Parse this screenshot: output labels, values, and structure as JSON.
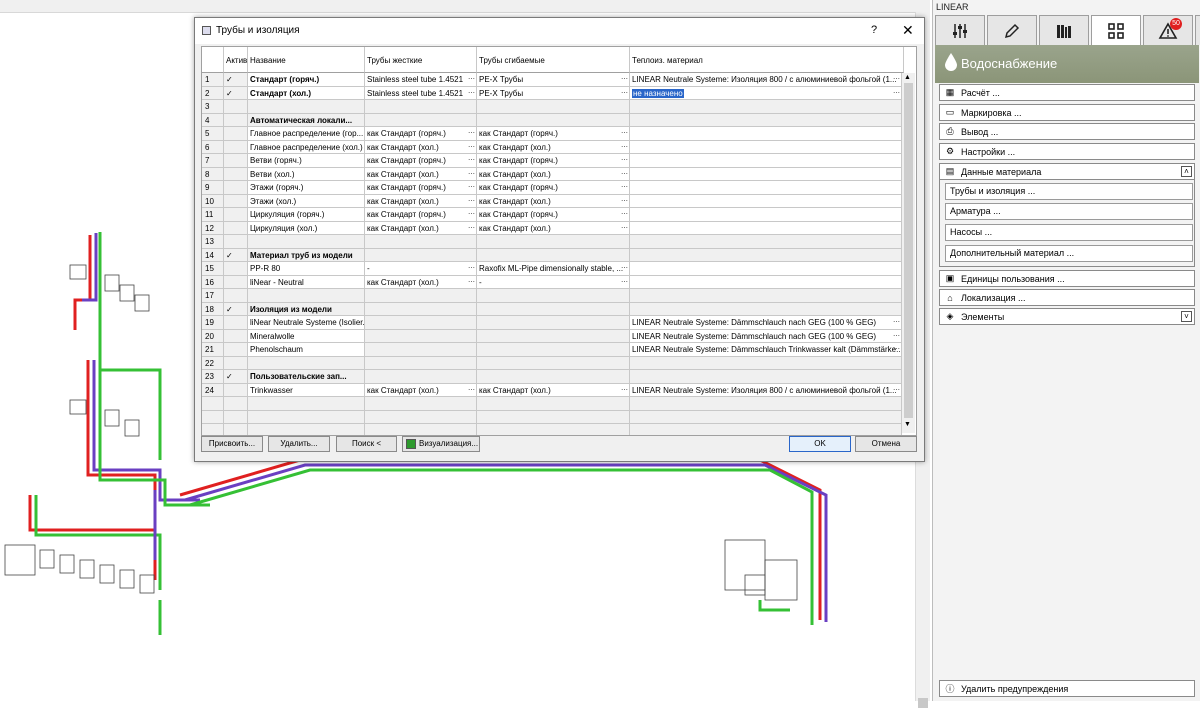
{
  "panel": {
    "title": "LINEAR",
    "badge_count": "50",
    "section_title": "Водоснабжение",
    "buttons": {
      "calc": "Расчёт ...",
      "marking": "Маркировка ...",
      "output": "Вывод ...",
      "settings": "Настройки ...",
      "material_data": "Данные материала",
      "units": "Единицы пользования ...",
      "localization": "Локализация ...",
      "elements": "Элементы",
      "delete_warnings": "Удалить предупреждения"
    },
    "sub_buttons": {
      "pipes": "Трубы и изоляция ...",
      "fittings": "Арматура ...",
      "pumps": "Насосы ...",
      "extra": "Дополнительный материал ..."
    },
    "colors": {
      "header": "#8b9578",
      "badge": "#e02020"
    }
  },
  "dialog": {
    "title": "Трубы и изоляция",
    "help": "?",
    "close": "✕",
    "columns": {
      "active": "Актив",
      "name": "Название",
      "rigid": "Трубы жесткие",
      "flexible": "Трубы сгибаемые",
      "insulation": "Теплоиз. материал"
    },
    "rows": [
      {
        "n": "1",
        "check": "✓",
        "name": "Стандарт (горяч.)",
        "bold": true,
        "rigid": "Stainless steel tube 1.4521",
        "flex": "PE-X Трубы",
        "ins": "LINEAR Neutrale Systeme: Изоляция 800 / с алюминиевой фольгой (1...",
        "w": true
      },
      {
        "n": "2",
        "check": "✓",
        "name": "Стандарт (хол.)",
        "bold": true,
        "rigid": "Stainless steel tube 1.4521",
        "flex": "PE-X Трубы",
        "ins": "не назначено",
        "w": true,
        "sel": true
      },
      {
        "n": "3",
        "check": "",
        "name": "",
        "rigid": "",
        "flex": "",
        "ins": ""
      },
      {
        "n": "4",
        "check": "",
        "name": "Автоматическая локали...",
        "bold": true,
        "rigid": "",
        "flex": "",
        "ins": ""
      },
      {
        "n": "5",
        "check": "",
        "name": "Главное распределение (гор...",
        "rigid": "как Стандарт (горяч.)",
        "flex": "как Стандарт (горяч.)",
        "ins": "",
        "w": true
      },
      {
        "n": "6",
        "check": "",
        "name": "Главное распределение (хол.)",
        "rigid": "как Стандарт (хол.)",
        "flex": "как Стандарт (хол.)",
        "ins": "",
        "w": true
      },
      {
        "n": "7",
        "check": "",
        "name": "Ветви (горяч.)",
        "rigid": "как Стандарт (горяч.)",
        "flex": "как Стандарт (горяч.)",
        "ins": "",
        "w": true
      },
      {
        "n": "8",
        "check": "",
        "name": "Ветви (хол.)",
        "rigid": "как Стандарт (хол.)",
        "flex": "как Стандарт (хол.)",
        "ins": "",
        "w": true
      },
      {
        "n": "9",
        "check": "",
        "name": "Этажи (горяч.)",
        "rigid": "как Стандарт (горяч.)",
        "flex": "как Стандарт (горяч.)",
        "ins": "",
        "w": true
      },
      {
        "n": "10",
        "check": "",
        "name": "Этажи (хол.)",
        "rigid": "как Стандарт (хол.)",
        "flex": "как Стандарт (хол.)",
        "ins": "",
        "w": true
      },
      {
        "n": "11",
        "check": "",
        "name": "Циркуляция (горяч.)",
        "rigid": "как Стандарт (горяч.)",
        "flex": "как Стандарт (горяч.)",
        "ins": "",
        "w": true
      },
      {
        "n": "12",
        "check": "",
        "name": "Циркуляция (хол.)",
        "rigid": "как Стандарт (хол.)",
        "flex": "как Стандарт (хол.)",
        "ins": "",
        "w": true
      },
      {
        "n": "13",
        "check": "",
        "name": "",
        "rigid": "",
        "flex": "",
        "ins": ""
      },
      {
        "n": "14",
        "check": "✓",
        "name": "Материал труб из модели",
        "bold": true,
        "rigid": "",
        "flex": "",
        "ins": ""
      },
      {
        "n": "15",
        "check": "",
        "name": "PP-R 80",
        "rigid": "-",
        "flex": "Raxofix ML-Pipe dimensionally stable, ...",
        "ins": "",
        "w": true
      },
      {
        "n": "16",
        "check": "",
        "name": "liNear - Neutral",
        "rigid": "как Стандарт (хол.)",
        "flex": "-",
        "ins": "",
        "w": true
      },
      {
        "n": "17",
        "check": "",
        "name": "",
        "rigid": "",
        "flex": "",
        "ins": ""
      },
      {
        "n": "18",
        "check": "✓",
        "name": "Изоляция из модели",
        "bold": true,
        "rigid": "",
        "flex": "",
        "ins": ""
      },
      {
        "n": "19",
        "check": "",
        "name": "liNear Neutrale Systeme (Isolier...",
        "rigid": "",
        "flex": "",
        "ins": "LINEAR Neutrale Systeme: Dämmschlauch nach GEG (100 % GEG)",
        "w": true
      },
      {
        "n": "20",
        "check": "",
        "name": "Mineralwolle",
        "rigid": "",
        "flex": "",
        "ins": "LINEAR Neutrale Systeme: Dämmschlauch nach GEG (100 % GEG)",
        "w": true
      },
      {
        "n": "21",
        "check": "",
        "name": "Phenolschaum",
        "rigid": "",
        "flex": "",
        "ins": "LINEAR Neutrale Systeme: Dämmschlauch Trinkwasser kalt (Dämmstärke...",
        "w": true
      },
      {
        "n": "22",
        "check": "",
        "name": "",
        "rigid": "",
        "flex": "",
        "ins": ""
      },
      {
        "n": "23",
        "check": "✓",
        "name": "Пользовательские зап...",
        "bold": true,
        "rigid": "",
        "flex": "",
        "ins": ""
      },
      {
        "n": "24",
        "check": "",
        "name": "Trinkwasser",
        "rigid": "как Стандарт (хол.)",
        "flex": "как Стандарт (хол.)",
        "ins": "LINEAR Neutrale Systeme: Изоляция 800 / с алюминиевой фольгой (1...",
        "w": true
      }
    ],
    "buttons": {
      "assign": "Присвоить...",
      "delete": "Удалить...",
      "search": "Поиск <",
      "visualize": "Визуализация...",
      "ok": "OK",
      "cancel": "Отмена"
    }
  }
}
